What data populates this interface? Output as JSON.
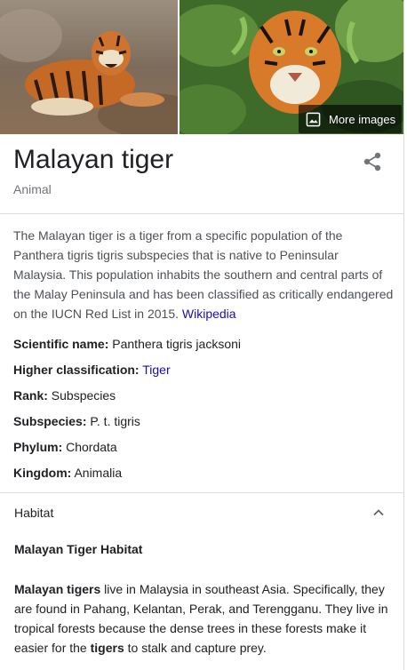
{
  "images": {
    "left_alt": "Malayan tiger resting on ground",
    "right_alt": "Tiger face among green leaves",
    "more_images_label": "More images"
  },
  "entity": {
    "title": "Malayan tiger",
    "subtitle": "Animal"
  },
  "description": {
    "text": "The Malayan tiger is a tiger from a specific population of the Panthera tigris tigris subspecies that is native to Peninsular Malaysia. This population inhabits the southern and central parts of the Malay Peninsula and has been classified as critically endangered on the IUCN Red List in 2015. ",
    "source_link": "Wikipedia"
  },
  "facts": [
    {
      "label": "Scientific name:",
      "value": " Panthera tigris jacksoni"
    },
    {
      "label": "Higher classification:",
      "value": "Tiger"
    },
    {
      "label": "Rank:",
      "value": " Subspecies"
    },
    {
      "label": "Subspecies:",
      "value": " P. t. tigris"
    },
    {
      "label": "Phylum:",
      "value": " Chordata"
    },
    {
      "label": "Kingdom:",
      "value": " Animalia"
    }
  ],
  "habitat": {
    "section_label": "Habitat",
    "heading": "Malayan Tiger Habitat",
    "para_bold_1": "Malayan tigers",
    "para_text_1": " live in Malaysia in southeast Asia. Specifically, they are found in Pahang, Kelantan, Perak, and Terengganu. They live in tropical forests because the dense trees in these forests make it easier for the ",
    "para_bold_2": "tigers",
    "para_text_2": " to stalk and capture prey."
  },
  "colors": {
    "link": "#1a0dab",
    "muted": "#70757a",
    "divider": "#dadce0"
  },
  "icons": {
    "image": "image-icon",
    "share": "share-icon",
    "collapse": "chevron-up-icon"
  }
}
